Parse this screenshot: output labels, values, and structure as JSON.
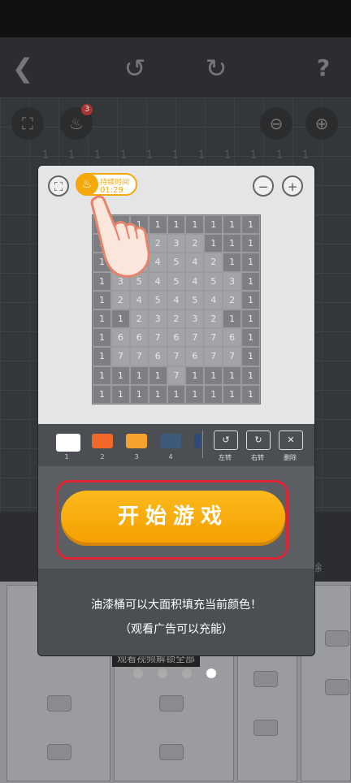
{
  "header": {
    "back_icon": "back-arrow-icon",
    "undo_icon": "undo-icon",
    "redo_icon": "redo-icon",
    "help_label": "?"
  },
  "background": {
    "bucket_badge": "3",
    "number_row": [
      "1",
      "1",
      "1",
      "1",
      "1",
      "1",
      "1",
      "1",
      "1",
      "1",
      "1"
    ],
    "delete_label": "除",
    "unlock_banner": "观看视频解锁全部"
  },
  "modal": {
    "timer": {
      "label": "持续时间",
      "value": "01:29"
    },
    "grid": [
      [
        "1",
        "1",
        "1",
        "1",
        "1",
        "1",
        "1",
        "1",
        "1"
      ],
      [
        "1",
        "1",
        "2",
        "2",
        "3",
        "2",
        "1",
        "1",
        "1"
      ],
      [
        "1",
        "2",
        "4",
        "4",
        "5",
        "4",
        "2",
        "1",
        "1"
      ],
      [
        "1",
        "3",
        "5",
        "4",
        "5",
        "4",
        "5",
        "3",
        "1"
      ],
      [
        "1",
        "2",
        "4",
        "5",
        "4",
        "5",
        "4",
        "2",
        "1"
      ],
      [
        "1",
        "1",
        "2",
        "3",
        "2",
        "3",
        "2",
        "1",
        "1"
      ],
      [
        "1",
        "6",
        "6",
        "7",
        "6",
        "7",
        "7",
        "6",
        "1"
      ],
      [
        "1",
        "7",
        "7",
        "6",
        "7",
        "6",
        "7",
        "7",
        "1"
      ],
      [
        "1",
        "1",
        "1",
        "1",
        "7",
        "1",
        "1",
        "1",
        "1"
      ],
      [
        "1",
        "1",
        "1",
        "1",
        "1",
        "1",
        "1",
        "1",
        "1"
      ]
    ],
    "palette": [
      {
        "label": "1",
        "color": "#ffffff"
      },
      {
        "label": "2",
        "color": "#f2682a"
      },
      {
        "label": "3",
        "color": "#f5a22e"
      },
      {
        "label": "4",
        "color": "#3d5a7a"
      }
    ],
    "tools": [
      {
        "label": "左转",
        "icon": "rotate-left-icon"
      },
      {
        "label": "右转",
        "icon": "rotate-right-icon"
      },
      {
        "label": "删除",
        "icon": "delete-icon"
      }
    ],
    "start_button": "开始游戏",
    "tip_line1": "油漆桶可以大面积填充当前颜色！",
    "tip_line2": "（观看广告可以充能）"
  },
  "pager": {
    "count": 4,
    "active": 4
  }
}
